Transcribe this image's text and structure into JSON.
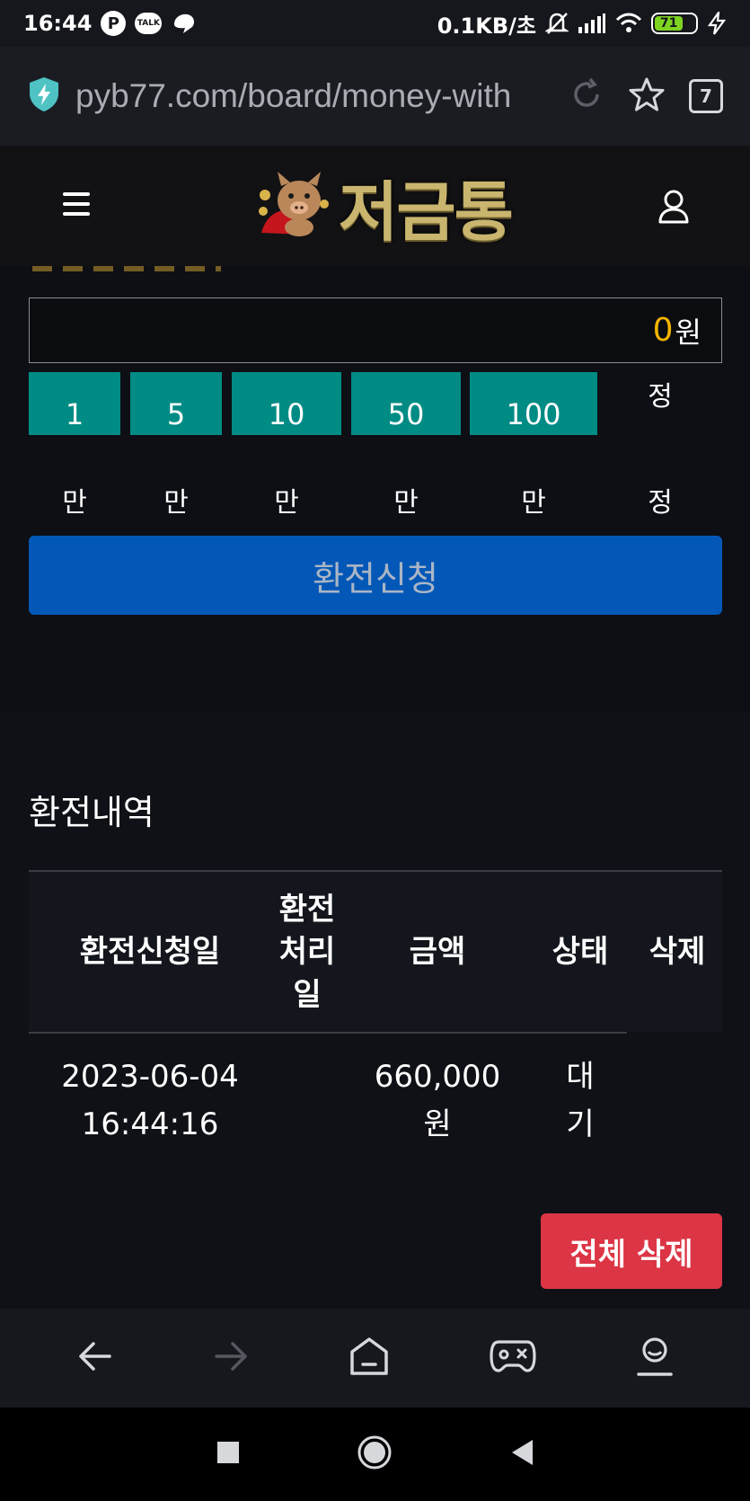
{
  "status_bar": {
    "time": "16:44",
    "p_icon": "P",
    "talk_icon": "TALK",
    "network_speed": "0.1KB/초",
    "battery_level": "71"
  },
  "browser": {
    "url": "pyb77.com/board/money-with",
    "tab_count": "7"
  },
  "site": {
    "logo_text": "저금통"
  },
  "exchange_form": {
    "amount_value": "0",
    "amount_unit": "원",
    "quick_buttons": [
      {
        "label": "1",
        "sub": "만"
      },
      {
        "label": "5",
        "sub": "만"
      },
      {
        "label": "10",
        "sub": "만"
      },
      {
        "label": "50",
        "sub": "만"
      },
      {
        "label": "100",
        "sub": "만"
      }
    ],
    "reset_label_top": "정",
    "reset_label_bottom": "정",
    "apply_label": "환전신청"
  },
  "history": {
    "title": "환전내역",
    "columns": [
      "환전신청일",
      "환전처리일",
      "금액",
      "상태",
      "삭제"
    ],
    "rows": [
      {
        "request_date": "2023-06-04",
        "request_time": "16:44:16",
        "process_date": "",
        "amount": "660,000",
        "amount_unit": "원",
        "status_a": "대",
        "status_b": "기"
      }
    ],
    "delete_all_label": "전체 삭제"
  },
  "colors": {
    "accent_teal": "#008b84",
    "apply_blue": "#0358b7",
    "danger_red": "#dc3545",
    "amount_gold": "#f5b400"
  }
}
